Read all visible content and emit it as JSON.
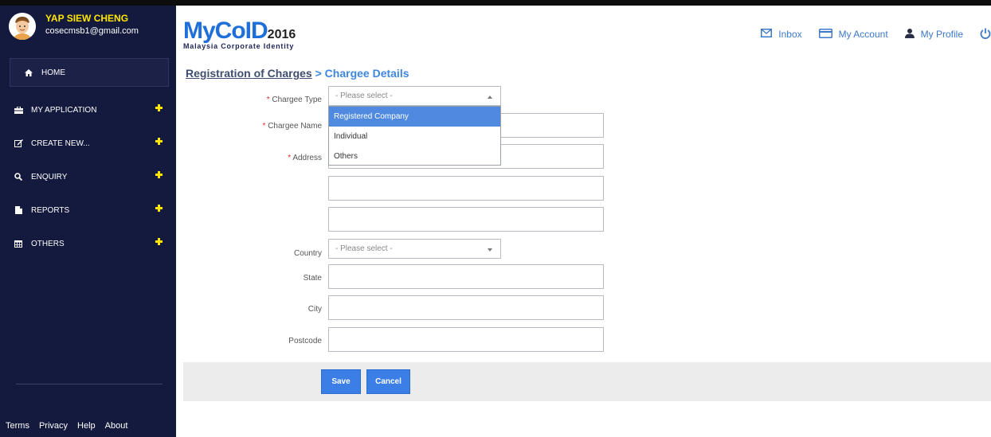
{
  "user": {
    "name": "YAP SIEW CHENG",
    "email": "cosecmsb1@gmail.com"
  },
  "sidebar": {
    "items": [
      {
        "label": "HOME",
        "icon": "home-icon"
      },
      {
        "label": "MY APPLICATION",
        "icon": "briefcase-icon"
      },
      {
        "label": "CREATE NEW...",
        "icon": "edit-icon"
      },
      {
        "label": "ENQUIRY",
        "icon": "search-icon"
      },
      {
        "label": "REPORTS",
        "icon": "file-icon"
      },
      {
        "label": "OTHERS",
        "icon": "calendar-icon"
      }
    ],
    "footer": [
      "Terms",
      "Privacy",
      "Help",
      "About"
    ]
  },
  "logo": {
    "main": "MyCoID",
    "year": "2016",
    "subtitle": "Malaysia Corporate Identity"
  },
  "topnav": {
    "inbox": "Inbox",
    "account": "My Account",
    "profile": "My Profile"
  },
  "page": {
    "breadcrumb": "Registration of Charges",
    "separator": ">",
    "current": "Chargee Details"
  },
  "form": {
    "chargee_type": {
      "label": "Chargee Type",
      "placeholder": "- Please select -"
    },
    "chargee_name": {
      "label": "Chargee Name"
    },
    "address": {
      "label": "Address"
    },
    "country": {
      "label": "Country",
      "placeholder": "- Please select -"
    },
    "state": {
      "label": "State"
    },
    "city": {
      "label": "City"
    },
    "postcode": {
      "label": "Postcode"
    },
    "chargee_type_options": [
      "Registered Company",
      "Individual",
      "Others"
    ]
  },
  "actions": {
    "save": "Save",
    "cancel": "Cancel"
  },
  "colors": {
    "sidebar_bg": "#141a3d",
    "accent": "#3a7ee6",
    "username": "#ffe600",
    "highlight": "#4f8ae0"
  }
}
